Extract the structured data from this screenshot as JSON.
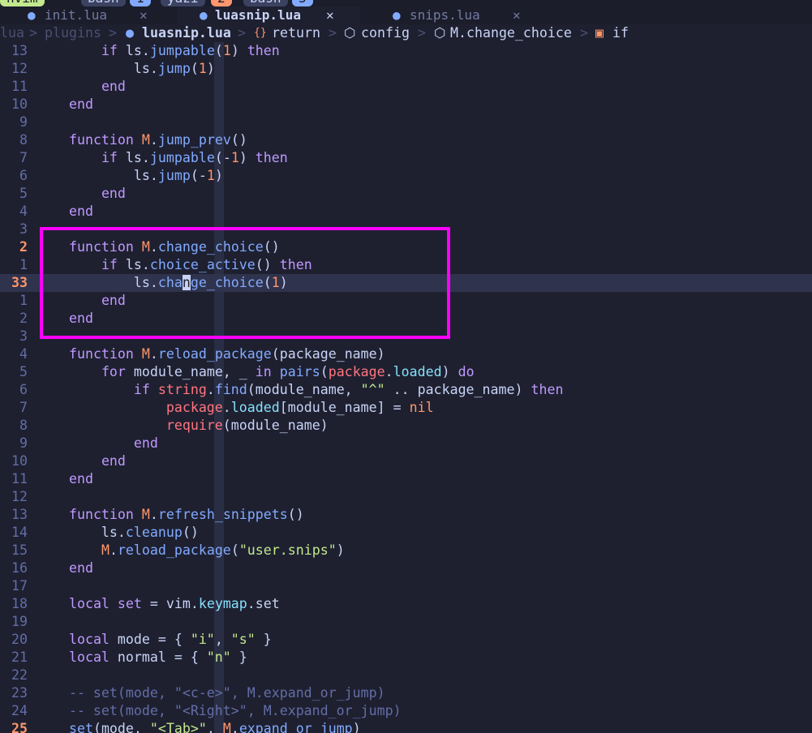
{
  "tmux": {
    "items": [
      {
        "label": "nvim",
        "bg": "#c3e88d",
        "fg": "#1b1d2b"
      },
      {
        "label": "bash",
        "bg": "#3b4261",
        "fg": "#c8d3f5"
      },
      {
        "label": "1",
        "bg": "#82aaff",
        "fg": "#1b1d2b"
      },
      {
        "label": "yazi",
        "bg": "#3b4261",
        "fg": "#c8d3f5"
      },
      {
        "label": "2",
        "bg": "#ff966c",
        "fg": "#1b1d2b"
      },
      {
        "label": "bash",
        "bg": "#3b4261",
        "fg": "#c8d3f5"
      },
      {
        "label": "3",
        "bg": "#82aaff",
        "fg": "#1b1d2b"
      }
    ]
  },
  "tabs": [
    {
      "name": "init.lua",
      "icon": "lua-file-icon",
      "close": "✕",
      "active": false
    },
    {
      "name": "luasnip.lua",
      "icon": "lua-file-icon",
      "close": "✕",
      "active": true
    },
    {
      "name": "snips.lua",
      "icon": "lua-file-icon",
      "close": "✕",
      "active": false
    }
  ],
  "winbar": {
    "lead": "lua",
    "sep": ">",
    "folder": "plugins",
    "file": "luasnip.lua",
    "return": "return",
    "config": "config",
    "func": "M.change_choice",
    "if": "if",
    "return_icon": "{}",
    "config_icon": "⬡",
    "func_icon": "⬡",
    "if_icon": "▣"
  },
  "lines": [
    {
      "n": "13",
      "tokens": [
        [
          "        ",
          "plain"
        ],
        [
          "if",
          "kw"
        ],
        [
          " ls.",
          "plain"
        ],
        [
          "jumpable",
          "fn"
        ],
        [
          "(",
          "plain"
        ],
        [
          "1",
          "num"
        ],
        [
          ")",
          "plain"
        ],
        [
          " then",
          "kw"
        ]
      ]
    },
    {
      "n": "12",
      "tokens": [
        [
          "            ls.",
          "plain"
        ],
        [
          "jump",
          "fn"
        ],
        [
          "(",
          "plain"
        ],
        [
          "1",
          "num"
        ],
        [
          ")",
          "plain"
        ]
      ]
    },
    {
      "n": "11",
      "tokens": [
        [
          "        ",
          "plain"
        ],
        [
          "end",
          "kw"
        ]
      ]
    },
    {
      "n": "10",
      "tokens": [
        [
          "    ",
          "plain"
        ],
        [
          "end",
          "kw"
        ]
      ]
    },
    {
      "n": "9",
      "tokens": []
    },
    {
      "n": "8",
      "tokens": [
        [
          "    ",
          "plain"
        ],
        [
          "function",
          "kw"
        ],
        [
          " ",
          "plain"
        ],
        [
          "M",
          "mod"
        ],
        [
          ".",
          "plain"
        ],
        [
          "jump_prev",
          "fn"
        ],
        [
          "()",
          "plain"
        ]
      ]
    },
    {
      "n": "7",
      "tokens": [
        [
          "        ",
          "plain"
        ],
        [
          "if",
          "kw"
        ],
        [
          " ls.",
          "plain"
        ],
        [
          "jumpable",
          "fn"
        ],
        [
          "(-",
          "plain"
        ],
        [
          "1",
          "num"
        ],
        [
          ")",
          "plain"
        ],
        [
          " then",
          "kw"
        ]
      ]
    },
    {
      "n": "6",
      "tokens": [
        [
          "            ls.",
          "plain"
        ],
        [
          "jump",
          "fn"
        ],
        [
          "(-",
          "plain"
        ],
        [
          "1",
          "num"
        ],
        [
          ")",
          "plain"
        ]
      ]
    },
    {
      "n": "5",
      "tokens": [
        [
          "        ",
          "plain"
        ],
        [
          "end",
          "kw"
        ]
      ]
    },
    {
      "n": "4",
      "tokens": [
        [
          "    ",
          "plain"
        ],
        [
          "end",
          "kw"
        ]
      ]
    },
    {
      "n": "3",
      "tokens": []
    },
    {
      "n": "2",
      "cur_hint": true,
      "tokens": [
        [
          "    ",
          "plain"
        ],
        [
          "function",
          "kw"
        ],
        [
          " ",
          "plain"
        ],
        [
          "M",
          "mod"
        ],
        [
          ".",
          "plain"
        ],
        [
          "change_choice",
          "fn"
        ],
        [
          "()",
          "plain"
        ]
      ]
    },
    {
      "n": "1",
      "tokens": [
        [
          "        ",
          "plain"
        ],
        [
          "if",
          "kw"
        ],
        [
          " ls.",
          "plain"
        ],
        [
          "choice_active",
          "fn"
        ],
        [
          "()",
          "plain"
        ],
        [
          " then",
          "kw"
        ]
      ]
    },
    {
      "n": "33",
      "current": true,
      "tokens": [
        [
          "            ls.",
          "plain"
        ],
        [
          "cha",
          "fn"
        ],
        [
          "n",
          "cursor"
        ],
        [
          "ge_choice",
          "fn"
        ],
        [
          "(",
          "plain"
        ],
        [
          "1",
          "num"
        ],
        [
          ")",
          "plain"
        ]
      ]
    },
    {
      "n": "1",
      "tokens": [
        [
          "        ",
          "plain"
        ],
        [
          "end",
          "kw"
        ]
      ]
    },
    {
      "n": "2",
      "tokens": [
        [
          "    ",
          "plain"
        ],
        [
          "end",
          "kw"
        ]
      ]
    },
    {
      "n": "3",
      "tokens": []
    },
    {
      "n": "4",
      "tokens": [
        [
          "    ",
          "plain"
        ],
        [
          "function",
          "kw"
        ],
        [
          " ",
          "plain"
        ],
        [
          "M",
          "mod"
        ],
        [
          ".",
          "plain"
        ],
        [
          "reload_package",
          "fn"
        ],
        [
          "(package_name)",
          "plain"
        ]
      ]
    },
    {
      "n": "5",
      "tokens": [
        [
          "        ",
          "plain"
        ],
        [
          "for",
          "kw"
        ],
        [
          " module_name, _ ",
          "plain"
        ],
        [
          "in",
          "kw"
        ],
        [
          " ",
          "plain"
        ],
        [
          "pairs",
          "fn"
        ],
        [
          "(",
          "plain"
        ],
        [
          "package",
          "bi"
        ],
        [
          ".",
          "plain"
        ],
        [
          "loaded",
          "field"
        ],
        [
          ") ",
          "plain"
        ],
        [
          "do",
          "kw"
        ]
      ]
    },
    {
      "n": "6",
      "tokens": [
        [
          "            ",
          "plain"
        ],
        [
          "if",
          "kw"
        ],
        [
          " ",
          "plain"
        ],
        [
          "string",
          "bi"
        ],
        [
          ".",
          "plain"
        ],
        [
          "find",
          "fn"
        ],
        [
          "(module_name, ",
          "plain"
        ],
        [
          "\"^\"",
          "str"
        ],
        [
          " .. package_name) ",
          "plain"
        ],
        [
          "then",
          "kw"
        ]
      ]
    },
    {
      "n": "7",
      "tokens": [
        [
          "                ",
          "plain"
        ],
        [
          "package",
          "bi"
        ],
        [
          ".",
          "plain"
        ],
        [
          "loaded",
          "field"
        ],
        [
          "[module_name] = ",
          "plain"
        ],
        [
          "nil",
          "num"
        ]
      ]
    },
    {
      "n": "8",
      "tokens": [
        [
          "                ",
          "plain"
        ],
        [
          "require",
          "bi"
        ],
        [
          "(module_name)",
          "plain"
        ]
      ]
    },
    {
      "n": "9",
      "tokens": [
        [
          "            ",
          "plain"
        ],
        [
          "end",
          "kw"
        ]
      ]
    },
    {
      "n": "10",
      "tokens": [
        [
          "        ",
          "plain"
        ],
        [
          "end",
          "kw"
        ]
      ]
    },
    {
      "n": "11",
      "tokens": [
        [
          "    ",
          "plain"
        ],
        [
          "end",
          "kw"
        ]
      ]
    },
    {
      "n": "12",
      "tokens": []
    },
    {
      "n": "13",
      "tokens": [
        [
          "    ",
          "plain"
        ],
        [
          "function",
          "kw"
        ],
        [
          " ",
          "plain"
        ],
        [
          "M",
          "mod"
        ],
        [
          ".",
          "plain"
        ],
        [
          "refresh_snippets",
          "fn"
        ],
        [
          "()",
          "plain"
        ]
      ]
    },
    {
      "n": "14",
      "tokens": [
        [
          "        ls.",
          "plain"
        ],
        [
          "cleanup",
          "fn"
        ],
        [
          "()",
          "plain"
        ]
      ]
    },
    {
      "n": "15",
      "tokens": [
        [
          "        ",
          "plain"
        ],
        [
          "M",
          "mod"
        ],
        [
          ".",
          "plain"
        ],
        [
          "reload_package",
          "fn"
        ],
        [
          "(",
          "plain"
        ],
        [
          "\"user.snips\"",
          "str"
        ],
        [
          ")",
          "plain"
        ]
      ]
    },
    {
      "n": "16",
      "tokens": [
        [
          "    ",
          "plain"
        ],
        [
          "end",
          "kw"
        ]
      ]
    },
    {
      "n": "17",
      "tokens": []
    },
    {
      "n": "18",
      "tokens": [
        [
          "    ",
          "plain"
        ],
        [
          "local",
          "kw"
        ],
        [
          " ",
          "plain"
        ],
        [
          "set",
          "kw"
        ],
        [
          " = vim.",
          "plain"
        ],
        [
          "keymap",
          "field"
        ],
        [
          ".set",
          "plain"
        ]
      ]
    },
    {
      "n": "19",
      "tokens": []
    },
    {
      "n": "20",
      "tokens": [
        [
          "    ",
          "plain"
        ],
        [
          "local",
          "kw"
        ],
        [
          " mode = { ",
          "plain"
        ],
        [
          "\"i\"",
          "str"
        ],
        [
          ", ",
          "plain"
        ],
        [
          "\"s\"",
          "str"
        ],
        [
          " }",
          "plain"
        ]
      ]
    },
    {
      "n": "21",
      "tokens": [
        [
          "    ",
          "plain"
        ],
        [
          "local",
          "kw"
        ],
        [
          " normal = { ",
          "plain"
        ],
        [
          "\"n\"",
          "str"
        ],
        [
          " }",
          "plain"
        ]
      ]
    },
    {
      "n": "22",
      "tokens": []
    },
    {
      "n": "23",
      "tokens": [
        [
          "    -- set(mode, \"<c-e>\", M.expand_or_jump)",
          "cmt"
        ]
      ]
    },
    {
      "n": "24",
      "tokens": [
        [
          "    -- set(mode, \"<Right>\", M.expand_or_jump)",
          "cmt"
        ]
      ]
    },
    {
      "n": "25",
      "next": true,
      "tokens": [
        [
          "    ",
          "plain"
        ],
        [
          "set",
          "fn"
        ],
        [
          "(mode, ",
          "plain"
        ],
        [
          "\"<Tab>\"",
          "str"
        ],
        [
          ", ",
          "plain"
        ],
        [
          "M",
          "mod"
        ],
        [
          ".",
          "plain"
        ],
        [
          "expand_or_jump",
          "fn"
        ],
        [
          ")",
          "plain"
        ]
      ]
    }
  ],
  "colors": {
    "background": "#1e2030",
    "cursorline": "#2f334d",
    "highlight_box": "#ff00ff",
    "keyword": "#c099ff",
    "function": "#82aaff",
    "string": "#c3e88d"
  }
}
